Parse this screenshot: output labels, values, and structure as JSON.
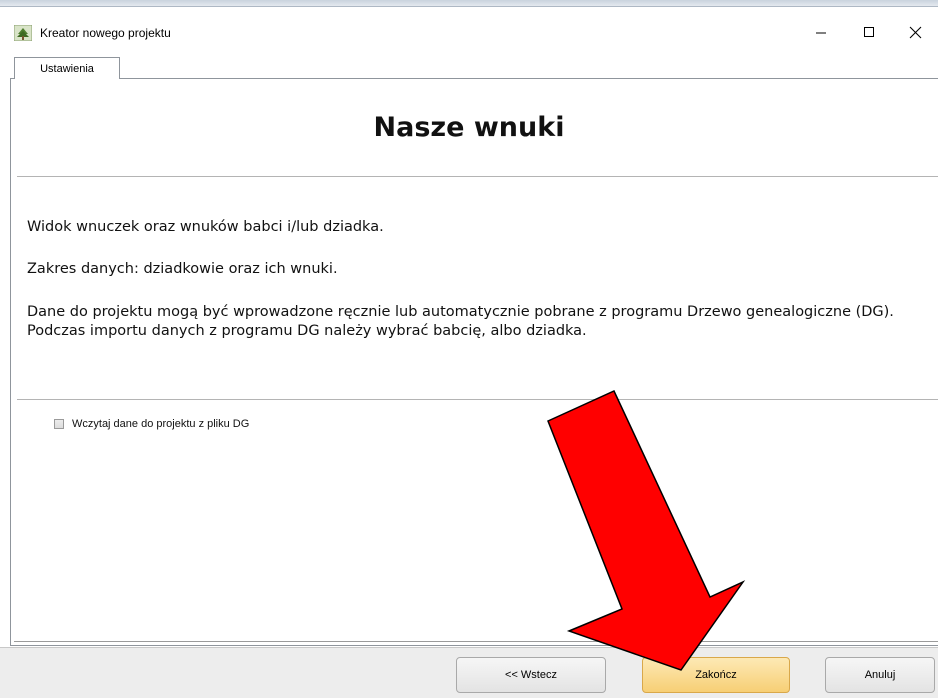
{
  "window": {
    "title": "Kreator nowego projektu",
    "icon": "tree-icon"
  },
  "tabs": [
    {
      "label": "Ustawienia",
      "active": true
    }
  ],
  "main": {
    "heading": "Nasze wnuki",
    "paragraphs": [
      "Widok wnuczek oraz wnuków babci i/lub dziadka.",
      "Zakres danych: dziadkowie oraz ich wnuki.",
      "Dane do projektu mogą być wprowadzone ręcznie lub automatycznie pobrane z programu Drzewo genealogiczne (DG). Podczas importu danych z programu DG należy wybrać babcię, albo dziadka."
    ],
    "checkbox": {
      "label": "Wczytaj dane do projektu z pliku DG",
      "checked": false
    }
  },
  "buttons": {
    "back": "<< Wstecz",
    "finish": "Zakończ",
    "cancel": "Anuluj"
  },
  "annotation": {
    "arrow_color": "#ff0000",
    "points_to": "finish-button"
  },
  "colors": {
    "primary_button": "#f7cf75",
    "arrow": "#ff0000"
  }
}
